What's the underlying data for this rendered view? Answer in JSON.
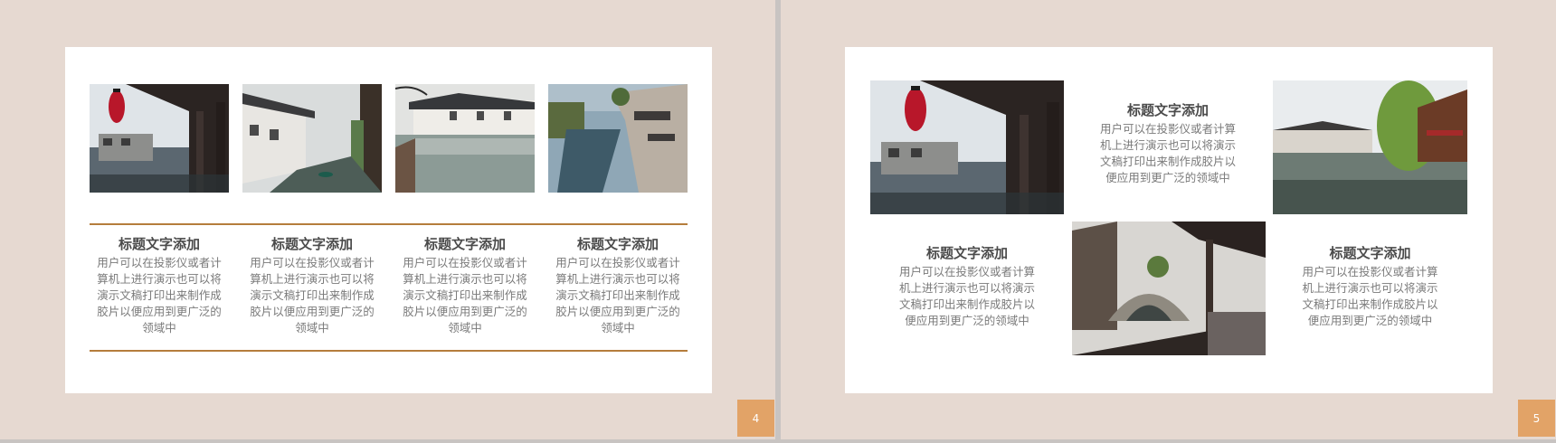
{
  "slides": [
    {
      "page_number": "4",
      "blocks": [
        {
          "title": "标题文字添加",
          "body": [
            "用户可以在投影仪或者计",
            "算机上进行演示也可以将",
            "演示文稿打印出来制作成",
            "胶片以便应用到更广泛的",
            "领域中"
          ]
        },
        {
          "title": "标题文字添加",
          "body": [
            "用户可以在投影仪或者计",
            "算机上进行演示也可以将",
            "演示文稿打印出来制作成",
            "胶片以便应用到更广泛的",
            "领域中"
          ]
        },
        {
          "title": "标题文字添加",
          "body": [
            "用户可以在投影仪或者计",
            "算机上进行演示也可以将",
            "演示文稿打印出来制作成",
            "胶片以便应用到更广泛的",
            "领域中"
          ]
        },
        {
          "title": "标题文字添加",
          "body": [
            "用户可以在投影仪或者计",
            "算机上进行演示也可以将",
            "演示文稿打印出来制作成",
            "胶片以便应用到更广泛的",
            "领域中"
          ]
        }
      ]
    },
    {
      "page_number": "5",
      "blocks": [
        {
          "title": "标题文字添加",
          "body": [
            "用户可以在投影仪或者计算",
            "机上进行演示也可以将演示",
            "文稿打印出来制作成胶片以",
            "便应用到更广泛的领域中"
          ]
        },
        {
          "title": "标题文字添加",
          "body": [
            "用户可以在投影仪或者计算",
            "机上进行演示也可以将演示",
            "文稿打印出来制作成胶片以",
            "便应用到更广泛的领域中"
          ]
        },
        {
          "title": "标题文字添加",
          "body": [
            "用户可以在投影仪或者计算",
            "机上进行演示也可以将演示",
            "文稿打印出来制作成胶片以",
            "便应用到更广泛的领域中"
          ]
        }
      ]
    }
  ],
  "colors": {
    "background": "#e6d9d1",
    "card": "#ffffff",
    "accent_line": "#b57d3c",
    "badge": "#e2a367",
    "title_text": "#4b4b4b",
    "body_text": "#7a7a7a"
  }
}
